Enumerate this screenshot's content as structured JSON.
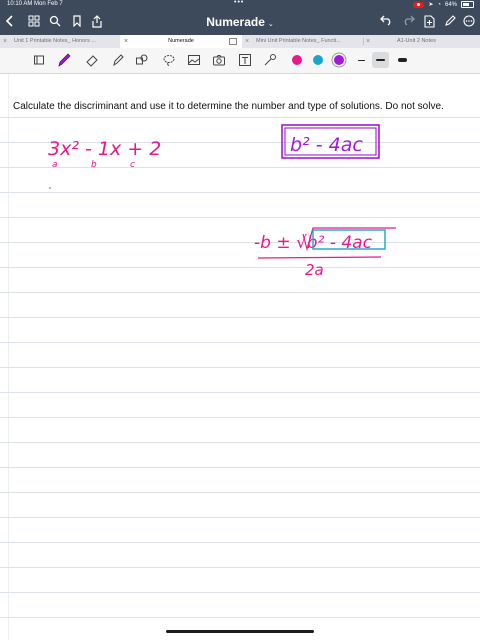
{
  "status": {
    "time_date": "10:10 AM  Mon Feb 7",
    "battery": "64%"
  },
  "nav": {
    "title": "Numerade"
  },
  "tabs": [
    {
      "label": "Unit 1 Printable Notes_ Honors ..."
    },
    {
      "label": "Numerade"
    },
    {
      "label": "Mini Unit  Printable Notes_ Functi..."
    },
    {
      "label": "A1-Unit 2 Notes"
    }
  ],
  "toolbar": {
    "tools": [
      "page-icon",
      "pen-icon",
      "eraser-icon",
      "highlighter-icon",
      "shapes-icon",
      "lasso-icon",
      "image-icon",
      "camera-icon",
      "text-icon",
      "laser-pointer-icon"
    ],
    "colors": [
      "#e8198b",
      "#1aa6c7",
      "#a21ad6"
    ],
    "selected_color": "#a21ad6"
  },
  "page": {
    "question": "Calculate the discriminant and use it to determine the number and type of solutions. Do not solve.",
    "ink_color": "#e8198b",
    "box_color": "#a21ad6",
    "highlight_color": "#1aa6c7",
    "handwriting": {
      "expression": "3x² - 1x + 2",
      "coef_a": "a",
      "coef_b": "b",
      "coef_c": "c",
      "discriminant": "b² - 4ac",
      "formula_numerator": "-b ± √b² - 4ac",
      "formula_denominator": "2a"
    }
  }
}
